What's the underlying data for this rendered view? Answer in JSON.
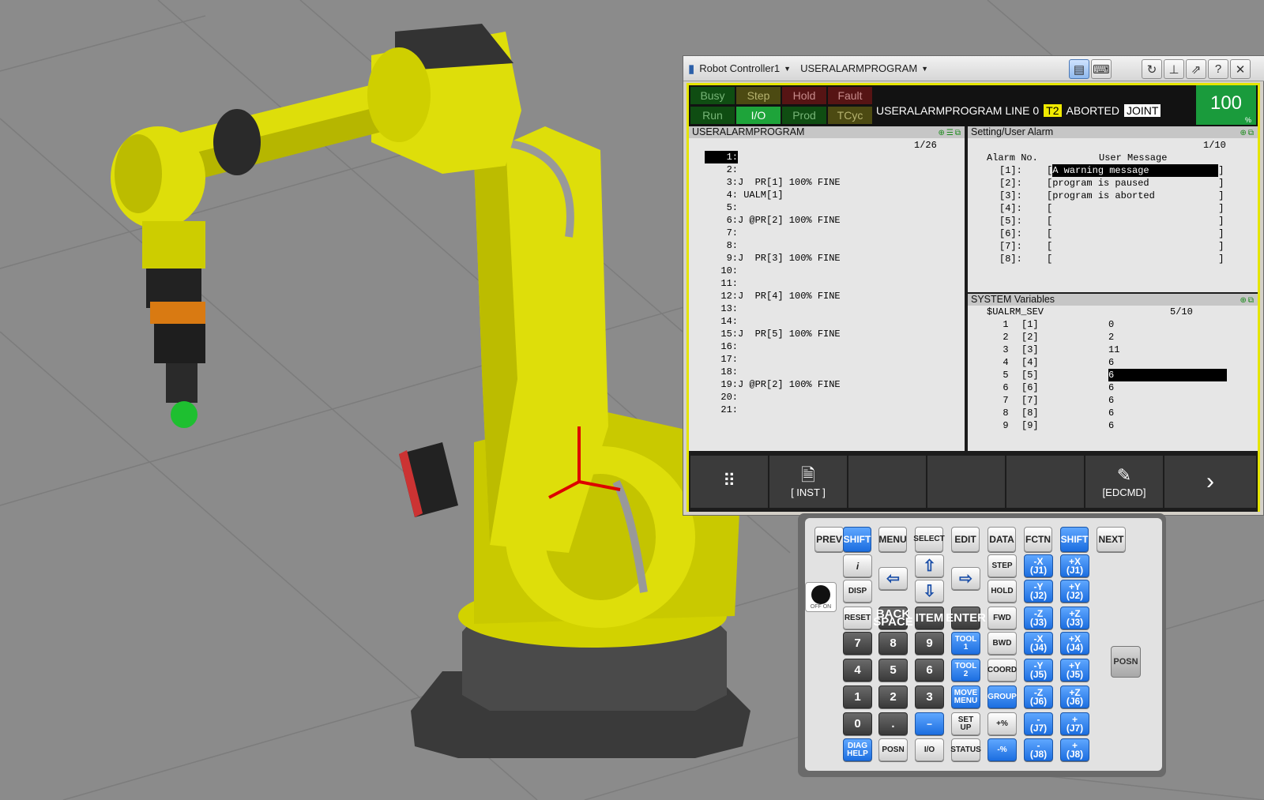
{
  "window": {
    "controller_name": "Robot Controller1",
    "program_name": "USERALARMPROGRAM"
  },
  "status": {
    "leds": {
      "busy": "Busy",
      "step": "Step",
      "hold": "Hold",
      "fault": "Fault",
      "run": "Run",
      "io": "I/O",
      "prod": "Prod",
      "tcyc": "TCyc"
    },
    "line_text": "USERALARMPROGRAM LINE 0",
    "mode": "T2",
    "state": "ABORTED",
    "coord": "JOINT",
    "override": "100",
    "override_unit": "%"
  },
  "program_pane": {
    "title": "USERALARMPROGRAM",
    "position": "1/26",
    "lines": [
      {
        "num": "1:",
        "text": ""
      },
      {
        "num": "2:",
        "text": ""
      },
      {
        "num": "3:",
        "text": "J  PR[1] 100% FINE"
      },
      {
        "num": "4:",
        "text": " UALM[1]"
      },
      {
        "num": "5:",
        "text": ""
      },
      {
        "num": "6:",
        "text": "J @PR[2] 100% FINE"
      },
      {
        "num": "7:",
        "text": ""
      },
      {
        "num": "8:",
        "text": ""
      },
      {
        "num": "9:",
        "text": "J  PR[3] 100% FINE"
      },
      {
        "num": "10:",
        "text": ""
      },
      {
        "num": "11:",
        "text": ""
      },
      {
        "num": "12:",
        "text": "J  PR[4] 100% FINE"
      },
      {
        "num": "13:",
        "text": ""
      },
      {
        "num": "14:",
        "text": ""
      },
      {
        "num": "15:",
        "text": "J  PR[5] 100% FINE"
      },
      {
        "num": "16:",
        "text": ""
      },
      {
        "num": "17:",
        "text": ""
      },
      {
        "num": "18:",
        "text": ""
      },
      {
        "num": "19:",
        "text": "J @PR[2] 100% FINE"
      },
      {
        "num": "20:",
        "text": ""
      },
      {
        "num": "21:",
        "text": ""
      }
    ]
  },
  "alarm_pane": {
    "title": "Setting/User Alarm",
    "position": "1/10",
    "col_alarm": "Alarm No.",
    "col_message": "User Message",
    "rows": [
      {
        "no": "[1]:",
        "msg": "A warning message"
      },
      {
        "no": "[2]:",
        "msg": "program is paused"
      },
      {
        "no": "[3]:",
        "msg": "program is aborted"
      },
      {
        "no": "[4]:",
        "msg": ""
      },
      {
        "no": "[5]:",
        "msg": ""
      },
      {
        "no": "[6]:",
        "msg": ""
      },
      {
        "no": "[7]:",
        "msg": ""
      },
      {
        "no": "[8]:",
        "msg": ""
      }
    ]
  },
  "sysvar_pane": {
    "title": "SYSTEM Variables",
    "variable": "$UALRM_SEV",
    "position": "5/10",
    "rows": [
      {
        "idx": "1",
        "name": "[1]",
        "val": "0"
      },
      {
        "idx": "2",
        "name": "[2]",
        "val": "2"
      },
      {
        "idx": "3",
        "name": "[3]",
        "val": "11"
      },
      {
        "idx": "4",
        "name": "[4]",
        "val": "6"
      },
      {
        "idx": "5",
        "name": "[5]",
        "val": "6"
      },
      {
        "idx": "6",
        "name": "[6]",
        "val": "6"
      },
      {
        "idx": "7",
        "name": "[7]",
        "val": "6"
      },
      {
        "idx": "8",
        "name": "[8]",
        "val": "6"
      },
      {
        "idx": "9",
        "name": "[9]",
        "val": "6"
      }
    ]
  },
  "function_keys": {
    "f2": "[ INST ]",
    "f6": "[EDCMD]"
  },
  "keypad": {
    "row0": [
      "PREV",
      "SHIFT",
      "MENU",
      "SELECT",
      "EDIT",
      "DATA",
      "FCTN",
      "SHIFT",
      "NEXT"
    ],
    "disp": "DISP",
    "step": "STEP",
    "hold": "HOLD",
    "reset": "RESET",
    "backspace": "BACK\nSPACE",
    "item": "ITEM",
    "enter": "ENTER",
    "fwd": "FWD",
    "bwd": "BWD",
    "coord": "COORD",
    "group": "GROUP",
    "tool1": "TOOL\n1",
    "tool2": "TOOL\n2",
    "move_menu": "MOVE\nMENU",
    "setup": "SET\nUP",
    "status": "STATUS",
    "diag": "DIAG\nHELP",
    "posn": "POSN",
    "io": "I/O",
    "plus_pct": "+%",
    "minus_pct": "-%",
    "digits": [
      "7",
      "8",
      "9",
      "4",
      "5",
      "6",
      "1",
      "2",
      "3",
      "0",
      "."
    ],
    "jog_minus": [
      "-X\n(J1)",
      "-Y\n(J2)",
      "-Z\n(J3)",
      "-X\n(J4)",
      "-Y\n(J5)",
      "-Z\n(J6)",
      "-\n(J7)",
      "-\n(J8)"
    ],
    "jog_plus": [
      "+X\n(J1)",
      "+Y\n(J2)",
      "+Z\n(J3)",
      "+X\n(J4)",
      "+Y\n(J5)",
      "+Z\n(J6)",
      "+\n(J7)",
      "+\n(J8)"
    ],
    "side_posn": "POSN",
    "switch_label": "OFF  ON"
  },
  "colors": {
    "robot_yellow": "#e6e60a",
    "background": "#8b8b8b",
    "tp_border": "#e5e500",
    "io_green": "#1ea43a",
    "override_green": "#1a9b3c",
    "key_blue": "#1c6ee0"
  }
}
